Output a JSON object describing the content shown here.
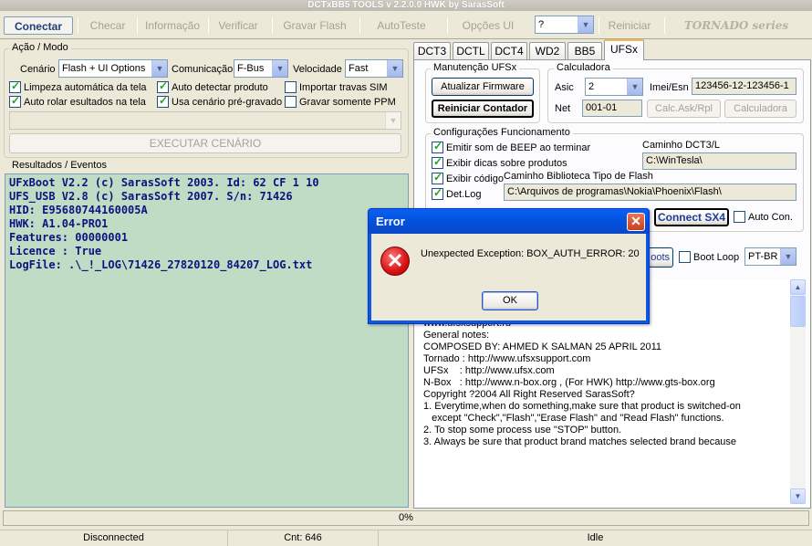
{
  "window": {
    "title": "DCTxBB5 TOOLS v 2.2.0.0 HWK by SarasSoft"
  },
  "toolbar": {
    "conectar": "Conectar",
    "checar": "Checar",
    "informacao": "Informação",
    "verificar": "Verificar",
    "gravar_flash": "Gravar Flash",
    "auto_teste": "AutoTeste",
    "opcoes_ui": "Opções UI",
    "help_value": "?",
    "reiniciar": "Reiniciar",
    "logo": "TORNADO series"
  },
  "acao": {
    "group": "Ação / Modo",
    "cenario_label": "Cenário",
    "cenario_value": "Flash + UI Options",
    "comunicacao_label": "Comunicação",
    "comunicacao_value": "F-Bus",
    "velocidade_label": "Velocidade",
    "velocidade_value": "Fast",
    "chk_limpeza": "Limpeza automática da tela",
    "chk_auto_detectar": "Auto detectar produto",
    "chk_importar": "Importar travas SIM",
    "chk_auto_rolar": "Auto rolar esultados na tela",
    "chk_usa_cenario": "Usa cenário pré-gravado",
    "chk_gravar_ppm": "Gravar somente PPM",
    "executar": "EXECUTAR CENÁRIO"
  },
  "resultados": {
    "group": "Resultados / Eventos",
    "lines": [
      "UFxBoot V2.2 (c) SarasSoft 2003. Id: 62 CF 1 10",
      "UFS_USB V2.8 (c) SarasSoft 2007. S/n: 71426",
      "HID: E95680744160005A",
      "HWK: A1.04-PRO1",
      "Features: 00000001",
      "Licence : True",
      "LogFile: .\\_!_LOG\\71426_27820120_84207_LOG.txt"
    ]
  },
  "tabs": [
    "DCT3",
    "DCTL",
    "DCT4",
    "WD2",
    "BB5",
    "UFSx"
  ],
  "manutencao": {
    "group": "Manutenção UFSx",
    "atualizar": "Atualizar Firmware",
    "reiniciar_contador": "Reiniciar Contador"
  },
  "calculadora": {
    "group": "Calculadora",
    "asic_label": "Asic",
    "asic_value": "2",
    "imei_label": "Imei/Esn",
    "imei_value": "123456-12-123456-1",
    "net_label": "Net",
    "net_value": "001-01",
    "calc_ask": "Calc.Ask/Rpl",
    "calculadora_btn": "Calculadora"
  },
  "config": {
    "group": "Configurações Funcionamento",
    "chk_beep": "Emitir som de BEEP ao terminar",
    "chk_dicas": "Exibir dicas sobre produtos",
    "chk_codigo": "Exibir código",
    "chk_detlog": "Det.Log",
    "caminho_dct3_label": "Caminho DCT3/L",
    "caminho_dct3_value": "C:\\WinTesla\\",
    "caminho_bib_label": "Caminho Biblioteca Tipo de Flash",
    "caminho_bib_value": "C:\\Arquivos de programas\\Nokia\\Phoenix\\Flash\\",
    "connect_sx4": "Connect SX4",
    "auto_con": "Auto Con.",
    "boots_partial": "oots",
    "boot_loop": "Boot Loop",
    "lang_value": "PT-BR"
  },
  "notes": {
    "lines": [
      "www.ufsxsupport.ru",
      "",
      "General notes:",
      "COMPOSED BY: AHMED K SALMAN 25 APRIL 2011",
      "Tornado : http://www.ufsxsupport.com",
      "UFSx    : http://www.ufsx.com",
      "N-Box   : http://www.n-box.org , (For HWK) http://www.gts-box.org",
      "",
      "",
      "Copyright ?2004 All Right Reserved SarasSoft?",
      "",
      "1. Everytime,when do something,make sure that product is switched-on",
      "   except \"Check\",\"Flash\",\"Erase Flash\" and \"Read Flash\" functions.",
      "2. To stop some process use \"STOP\" button.",
      "3. Always be sure that product brand matches selected brand because"
    ]
  },
  "progress": {
    "text": "0%",
    "value": 0
  },
  "status": {
    "connection": "Disconnected",
    "cnt": "Cnt: 646",
    "state": "Idle"
  },
  "dialog": {
    "title": "Error",
    "message": "Unexpected Exception: BOX_AUTH_ERROR: 20",
    "ok": "OK"
  }
}
